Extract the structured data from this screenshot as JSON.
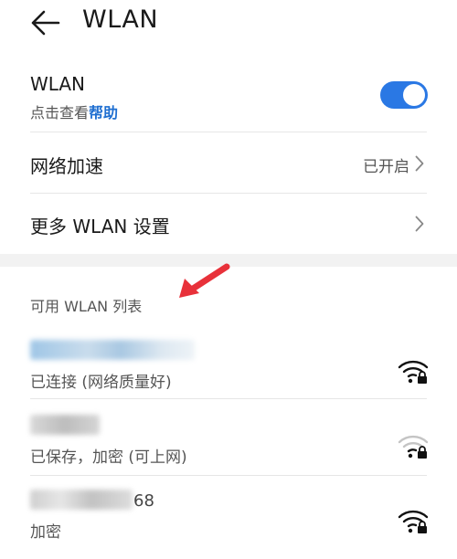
{
  "header": {
    "title": "WLAN"
  },
  "wlan": {
    "title": "WLAN",
    "help_prefix": "点击查看",
    "help_link": "帮助",
    "enabled": true
  },
  "rows": {
    "accel": {
      "label": "网络加速",
      "value": "已开启"
    },
    "more": {
      "label": "更多 WLAN 设置"
    }
  },
  "available": {
    "title": "可用 WLAN 列表",
    "networks": [
      {
        "ssid": "",
        "status": "已连接 (网络质量好)",
        "signal": "strong",
        "locked": true
      },
      {
        "ssid": "",
        "status": "已保存，加密 (可上网)",
        "signal": "weak",
        "locked": true
      },
      {
        "ssid_suffix": "68",
        "status": "加密",
        "signal": "strong",
        "locked": true
      }
    ]
  },
  "colors": {
    "accent": "#2a78e4",
    "link": "#1f6fd1",
    "arrow": "#e8313a"
  }
}
